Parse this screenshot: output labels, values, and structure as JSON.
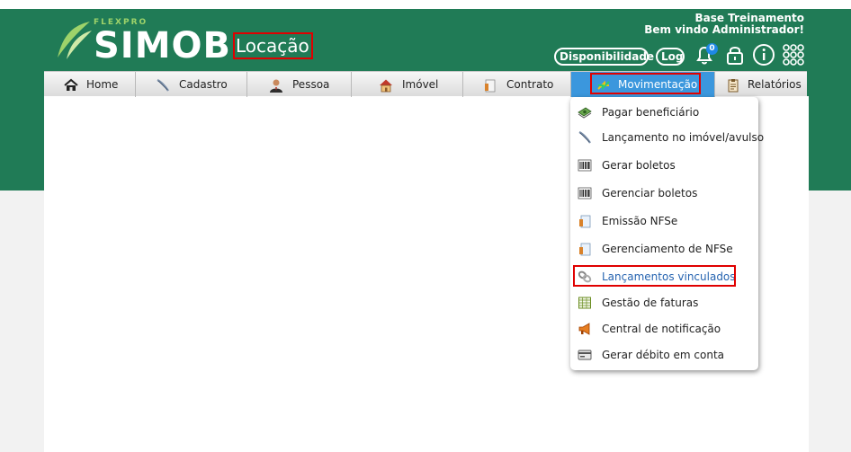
{
  "header": {
    "brand_top": "FLEXPRO",
    "brand": "SIMOB",
    "module": "Locação",
    "welcome_line1": "Base Treinamento",
    "welcome_line2": "Bem vindo Administrador!",
    "buttons": {
      "disponibilidade": "Disponibilidade",
      "log": "Log"
    },
    "notification_count": "0"
  },
  "nav": [
    {
      "label": "Home",
      "icon": "house-icon"
    },
    {
      "label": "Cadastro",
      "icon": "feather-icon"
    },
    {
      "label": "Pessoa",
      "icon": "person-icon"
    },
    {
      "label": "Imóvel",
      "icon": "house-icon"
    },
    {
      "label": "Contrato",
      "icon": "document-icon"
    },
    {
      "label": "Movimentação",
      "icon": "arrows-icon"
    },
    {
      "label": "Relatórios",
      "icon": "clipboard-icon"
    }
  ],
  "menu": [
    {
      "label": "Pagar beneficiário",
      "icon": "money-icon"
    },
    {
      "label": "Lançamento no imóvel/avulso",
      "icon": "feather-icon"
    },
    {
      "label": "Gerar boletos",
      "icon": "barcode-icon"
    },
    {
      "label": "Gerenciar boletos",
      "icon": "barcode-icon"
    },
    {
      "label": "Emissão NFSe",
      "icon": "document-icon"
    },
    {
      "label": "Gerenciamento de NFSe",
      "icon": "document-icon"
    },
    {
      "label": "Lançamentos vinculados",
      "icon": "chain-icon"
    },
    {
      "label": "Gestão de faturas",
      "icon": "spreadsheet-icon"
    },
    {
      "label": "Central de notificação",
      "icon": "megaphone-icon"
    },
    {
      "label": "Gerar débito em conta",
      "icon": "card-icon"
    }
  ],
  "colors": {
    "brand_green": "#207b56",
    "active_tab": "#3b97dd",
    "highlight": "#e00000",
    "selected_link": "#2563b0"
  }
}
